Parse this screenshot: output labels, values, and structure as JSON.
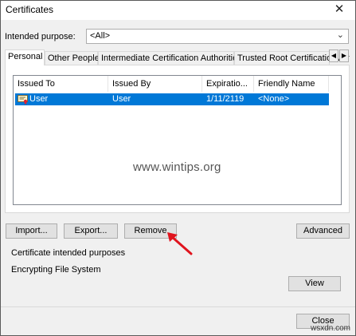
{
  "window": {
    "title": "Certificates",
    "close_glyph": "✕"
  },
  "purpose": {
    "label": "Intended purpose:",
    "value": "<All>"
  },
  "tabs": [
    {
      "label": "Personal"
    },
    {
      "label": "Other People"
    },
    {
      "label": "Intermediate Certification Authorities"
    },
    {
      "label": "Trusted Root Certification Authorities"
    }
  ],
  "list": {
    "columns": [
      "Issued To",
      "Issued By",
      "Expiratio...",
      "Friendly Name"
    ],
    "rows": [
      {
        "issued_to": "User",
        "issued_by": "User",
        "expiration": "1/11/2119",
        "friendly_name": "<None>",
        "selected": true
      }
    ]
  },
  "watermark": "www.wintips.org",
  "buttons": {
    "import": "Import...",
    "export": "Export...",
    "remove": "Remove",
    "advanced": "Advanced",
    "view": "View",
    "close": "Close"
  },
  "purposes": {
    "title": "Certificate intended purposes",
    "value": "Encrypting File System"
  },
  "site_watermark": "wsxdn.com",
  "colors": {
    "selection": "#0078d7",
    "arrow": "#e0141e"
  }
}
